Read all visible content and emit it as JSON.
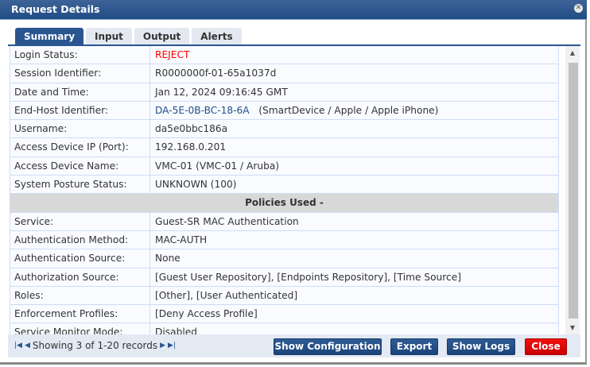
{
  "window": {
    "title": "Request Details"
  },
  "tabs": [
    "Summary",
    "Input",
    "Output",
    "Alerts"
  ],
  "rows": [
    {
      "k": "Login Status:",
      "v": "REJECT"
    },
    {
      "k": "Session Identifier:",
      "v": "R0000000f-01-65a1037d"
    },
    {
      "k": "Date and Time:",
      "v": "Jan 12, 2024 09:16:45 GMT"
    },
    {
      "k": "End-Host Identifier:",
      "v": "DA-5E-0B-BC-18-6A",
      "v2": "(SmartDevice / Apple / Apple iPhone)"
    },
    {
      "k": "Username:",
      "v": "da5e0bbc186a"
    },
    {
      "k": "Access Device IP (Port):",
      "v": "192.168.0.201"
    },
    {
      "k": "Access Device Name:",
      "v": "VMC-01 (VMC-01 / Aruba)"
    },
    {
      "k": "System Posture Status:",
      "v": "UNKNOWN (100)"
    }
  ],
  "section": "Policies Used -",
  "policies": [
    {
      "k": "Service:",
      "v": "Guest-SR MAC Authentication"
    },
    {
      "k": "Authentication Method:",
      "v": "MAC-AUTH"
    },
    {
      "k": "Authentication Source:",
      "v": "None"
    },
    {
      "k": "Authorization Source:",
      "v": "[Guest User Repository], [Endpoints Repository], [Time Source]"
    },
    {
      "k": "Roles:",
      "v": "[Other], [User Authenticated]"
    },
    {
      "k": "Enforcement Profiles:",
      "v": "[Deny Access Profile]"
    },
    {
      "k": "Service Monitor Mode:",
      "v": "Disabled"
    }
  ],
  "footer": {
    "pager": "Showing 3 of 1-20 records",
    "show_config": "Show Configuration",
    "export": "Export",
    "show_logs": "Show Logs",
    "close": "Close"
  },
  "colors": {
    "reject": "#ff0000",
    "link": "#1f4e8c",
    "accent": "#2a5591"
  }
}
